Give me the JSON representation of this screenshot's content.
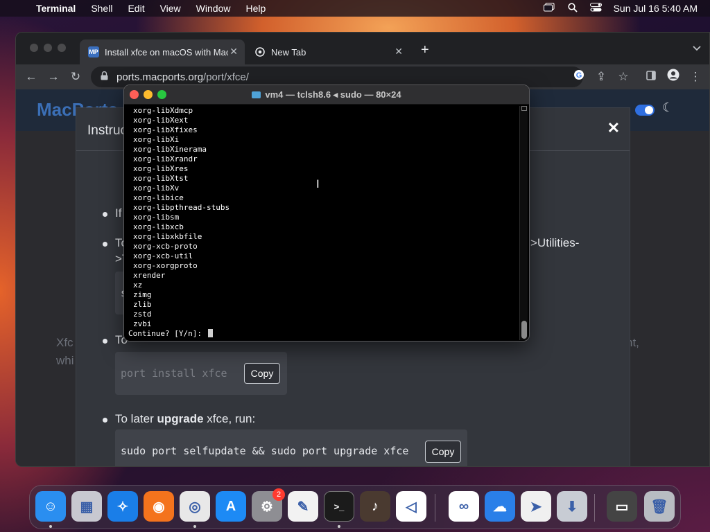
{
  "menubar": {
    "app_name": "Terminal",
    "items": [
      "Shell",
      "Edit",
      "View",
      "Window",
      "Help"
    ],
    "clock": "Sun Jul 16  5:40 AM"
  },
  "browser": {
    "tabs": [
      {
        "label": "Install xfce on macOS with Mac",
        "favicon": "MP"
      },
      {
        "label": "New Tab"
      }
    ],
    "url_host": "ports.macports.org",
    "url_path": "/port/xfce/"
  },
  "page": {
    "brand": "MacPorts",
    "modal_title": "Instructions",
    "bullets": [
      {
        "text": "If"
      },
      {
        "text": "To",
        "tail": ">Utilities-",
        "tail2": ">T"
      },
      {
        "text": "To"
      },
      {
        "text_pre": "To later ",
        "text_bold": "upgrade",
        "text_post": " xfce, run:"
      }
    ],
    "bg_text_1": "Xfc",
    "bg_text_2": "whi",
    "bg_text_right": "nt,",
    "code_partial_1": "s",
    "code_partial_2": "port install xfce",
    "upgrade_code": "sudo port selfupdate && sudo port upgrade xfce",
    "copy_label": "Copy"
  },
  "terminal": {
    "title": "vm4 — tclsh8.6 ◂ sudo — 80×24",
    "packages": [
      "xorg-libXdmcp",
      "xorg-libXext",
      "xorg-libXfixes",
      "xorg-libXi",
      "xorg-libXinerama",
      "xorg-libXrandr",
      "xorg-libXres",
      "xorg-libXtst",
      "xorg-libXv",
      "xorg-libice",
      "xorg-libpthread-stubs",
      "xorg-libsm",
      "xorg-libxcb",
      "xorg-libxkbfile",
      "xorg-xcb-proto",
      "xorg-xcb-util",
      "xorg-xorgproto",
      "xrender",
      "xz",
      "zimg",
      "zlib",
      "zstd",
      "zvbi"
    ],
    "prompt": "Continue? [Y/n]: "
  },
  "dock": {
    "settings_badge": "2",
    "apps": [
      {
        "name": "finder-icon",
        "color": "#2a8ef0"
      },
      {
        "name": "launchpad-icon",
        "color": "#c8c8d0"
      },
      {
        "name": "safari-icon",
        "color": "#1a7ee8"
      },
      {
        "name": "firefox-icon",
        "color": "#f4731d"
      },
      {
        "name": "chrome-icon",
        "color": "#e8e8e8"
      },
      {
        "name": "app-store-icon",
        "color": "#1d8af5"
      },
      {
        "name": "system-settings-icon",
        "color": "#8e8e93"
      },
      {
        "name": "textedit-icon",
        "color": "#f2f2f2"
      },
      {
        "name": "terminal-icon",
        "color": "#1b1b1b"
      },
      {
        "name": "garageband-icon",
        "color": "#4a3a30"
      },
      {
        "name": "vscode-icon",
        "color": "#ffffff"
      },
      {
        "name": "visual-studio-icon",
        "color": "#ffffff"
      },
      {
        "name": "icloud-icon",
        "color": "#2a7fe8"
      },
      {
        "name": "maps-icon",
        "color": "#f0f0f0"
      },
      {
        "name": "installer-icon",
        "color": "#c8ccd4"
      },
      {
        "name": "window-stack-icon",
        "color": "#444"
      },
      {
        "name": "trash-icon",
        "color": "#b8bcc2"
      }
    ]
  }
}
